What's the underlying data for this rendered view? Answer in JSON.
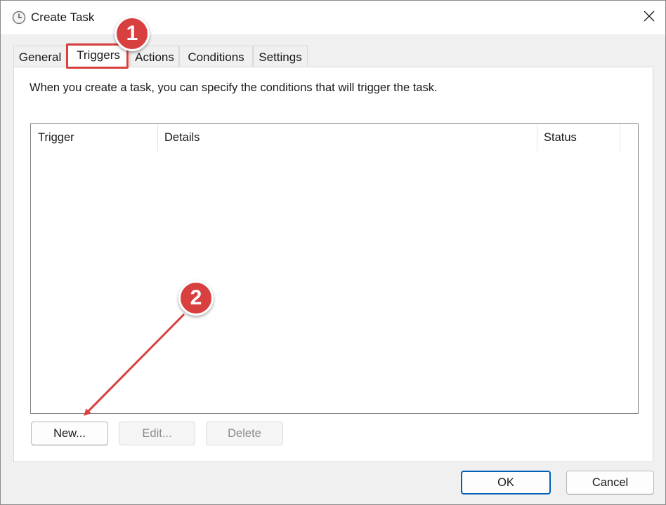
{
  "window": {
    "title": "Create Task",
    "icons": {
      "app": "clock-icon",
      "close": "close-icon"
    }
  },
  "tabs": [
    {
      "label": "General",
      "active": false
    },
    {
      "label": "Triggers",
      "active": true
    },
    {
      "label": "Actions",
      "active": false
    },
    {
      "label": "Conditions",
      "active": false
    },
    {
      "label": "Settings",
      "active": false
    }
  ],
  "triggers_panel": {
    "description": "When you create a task, you can specify the conditions that will trigger the task.",
    "columns": [
      "Trigger",
      "Details",
      "Status"
    ],
    "rows": [],
    "buttons": {
      "new": "New...",
      "edit": "Edit...",
      "delete": "Delete"
    }
  },
  "footer": {
    "ok": "OK",
    "cancel": "Cancel"
  },
  "annotations": {
    "marker1": "1",
    "marker2": "2",
    "color": "#d8403f"
  }
}
